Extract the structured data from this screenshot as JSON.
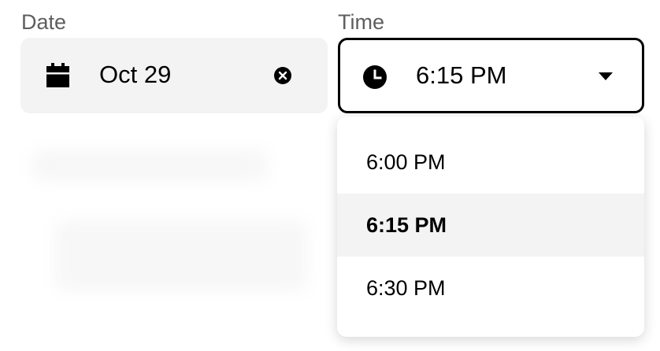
{
  "date": {
    "label": "Date",
    "value": "Oct 29",
    "icon": "calendar-icon",
    "clear_icon": "clear-icon"
  },
  "time": {
    "label": "Time",
    "value": "6:15 PM",
    "icon": "clock-icon",
    "caret_icon": "caret-down-icon",
    "options": [
      {
        "label": "6:00 PM",
        "selected": false
      },
      {
        "label": "6:15 PM",
        "selected": true
      },
      {
        "label": "6:30 PM",
        "selected": false
      }
    ]
  },
  "colors": {
    "label_gray": "#5e5e5e",
    "field_bg": "#f3f3f3",
    "border_active": "#000000",
    "highlight_bg": "#f3f3f3"
  }
}
